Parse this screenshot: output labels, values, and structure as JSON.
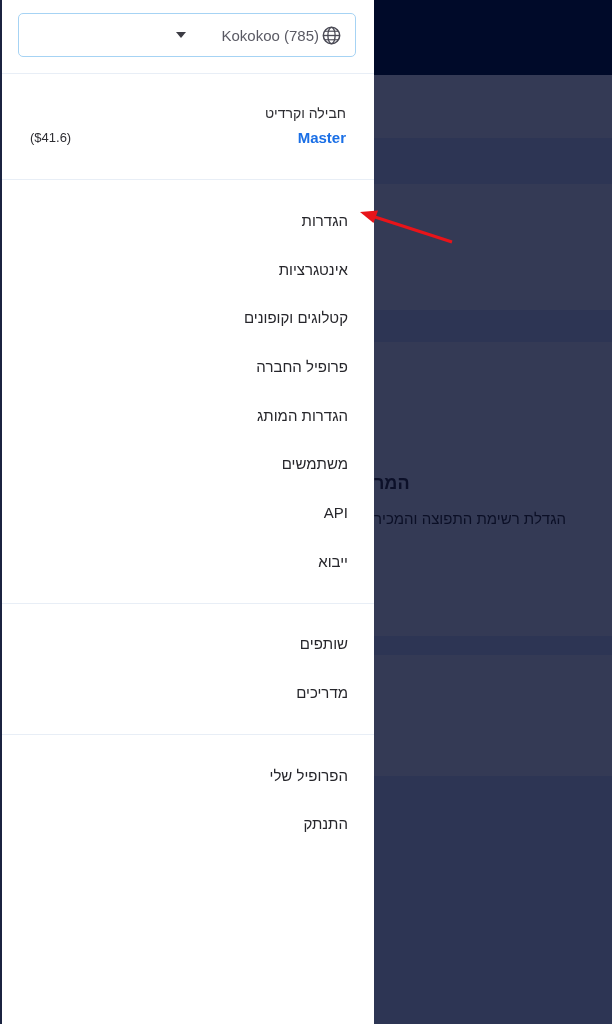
{
  "account_selector": {
    "value": "Kokokoo (785)"
  },
  "plan": {
    "label": "חבילה וקרדיט",
    "name": "Master",
    "credit": "($41.6)"
  },
  "menu_sections": [
    {
      "items": [
        {
          "label": "הגדרות"
        },
        {
          "label": "אינטגרציות"
        },
        {
          "label": "קטלוגים וקופונים"
        },
        {
          "label": "פרופיל החברה"
        },
        {
          "label": "הגדרות המותג"
        },
        {
          "label": "משתמשים"
        },
        {
          "label": "API"
        },
        {
          "label": "ייבוא"
        }
      ]
    },
    {
      "items": [
        {
          "label": "שותפים"
        },
        {
          "label": "מדריכים"
        }
      ]
    },
    {
      "items": [
        {
          "label": "הפרופיל שלי"
        },
        {
          "label": "התנתק"
        }
      ]
    }
  ],
  "page_behind": {
    "heading": "המר",
    "subtitle": "הגדלת רשימת התפוצה והמכיר"
  }
}
